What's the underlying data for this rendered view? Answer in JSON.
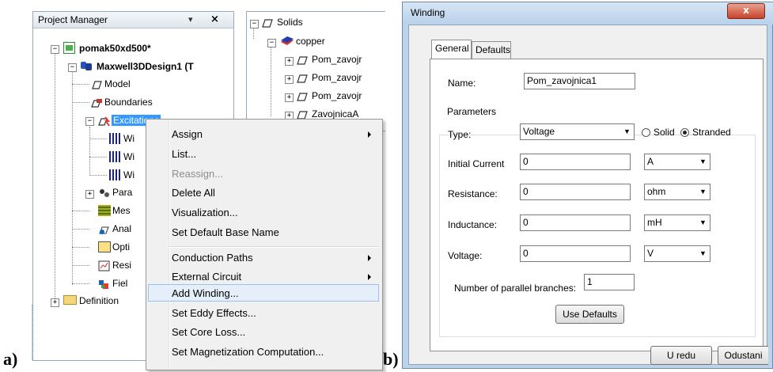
{
  "figure_labels": {
    "a": "a)",
    "b": "b)"
  },
  "project_manager": {
    "title": "Project Manager",
    "pin": "▾",
    "close": "×",
    "tree": [
      {
        "label": "pomak50xd500*",
        "bold": true,
        "expander": "−"
      },
      {
        "label": "Maxwell3DDesign1 (T",
        "bold": true,
        "expander": "−"
      },
      {
        "label": "Model"
      },
      {
        "label": "Boundaries"
      },
      {
        "label": "Excitations",
        "expander": "−",
        "selected": true
      },
      {
        "label": "Wi"
      },
      {
        "label": "Wi"
      },
      {
        "label": "Wi"
      },
      {
        "label": "Para",
        "expander": "+"
      },
      {
        "label": "Mes"
      },
      {
        "label": "Anal"
      },
      {
        "label": "Opti"
      },
      {
        "label": "Resi"
      },
      {
        "label": "Fiel"
      },
      {
        "label": "Definition",
        "expander": "+"
      }
    ]
  },
  "solids_tree": {
    "items": [
      {
        "label": "Solids",
        "expander": "−"
      },
      {
        "label": "copper",
        "expander": "−"
      },
      {
        "label": "Pom_zavojr",
        "expander": "+"
      },
      {
        "label": "Pom_zavojr",
        "expander": "+"
      },
      {
        "label": "Pom_zavojr",
        "expander": "+"
      },
      {
        "label": "ZavojnicaA",
        "expander": "+"
      }
    ]
  },
  "context_menu": {
    "items": [
      {
        "label": "Assign",
        "submenu": true,
        "enabled": true
      },
      {
        "label": "List...",
        "submenu": false,
        "enabled": true
      },
      {
        "label": "Reassign...",
        "submenu": false,
        "enabled": false
      },
      {
        "label": "Delete All",
        "submenu": false,
        "enabled": true
      },
      {
        "label": "Visualization...",
        "submenu": false,
        "enabled": true
      },
      {
        "label": "Set Default Base Name",
        "submenu": false,
        "enabled": true
      },
      {
        "label": "Conduction Paths",
        "submenu": true,
        "enabled": true
      },
      {
        "label": "External Circuit",
        "submenu": true,
        "enabled": true
      },
      {
        "label": "Add Winding...",
        "submenu": false,
        "enabled": true,
        "highlighted": true
      },
      {
        "label": "Set Eddy Effects...",
        "submenu": false,
        "enabled": true
      },
      {
        "label": "Set Core Loss...",
        "submenu": false,
        "enabled": true
      },
      {
        "label": "Set Magnetization Computation...",
        "submenu": false,
        "enabled": true
      }
    ]
  },
  "winding_dialog": {
    "title": "Winding",
    "close": "x",
    "tabs": [
      "General",
      "Defaults"
    ],
    "active_tab": "General",
    "name_label": "Name:",
    "name_value": "Pom_zavojnica1",
    "group_label": "Parameters",
    "type_label": "Type:",
    "type_value": "Voltage",
    "solid_label": "Solid",
    "stranded_label": "Stranded",
    "selected_mode": "Stranded",
    "rows": [
      {
        "label": "Initial Current",
        "value": "0",
        "unit": "A"
      },
      {
        "label": "Resistance:",
        "value": "0",
        "unit": "ohm"
      },
      {
        "label": "Inductance:",
        "value": "0",
        "unit": "mH"
      },
      {
        "label": "Voltage:",
        "value": "0",
        "unit": "V"
      }
    ],
    "branches_label": "Number of parallel branches:",
    "branches_value": "1",
    "use_defaults": "Use Defaults",
    "ok": "U redu",
    "cancel": "Odustani"
  }
}
